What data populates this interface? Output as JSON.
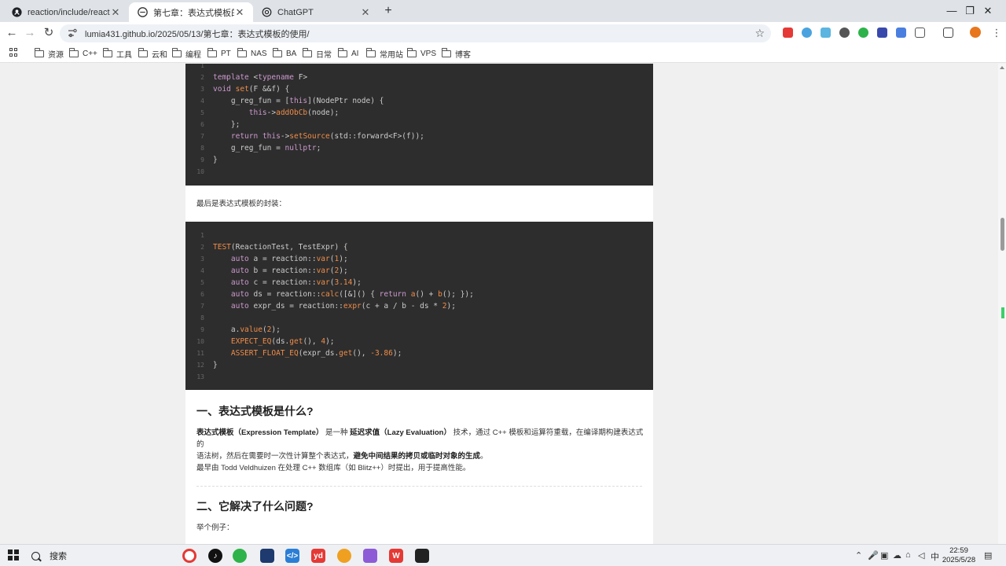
{
  "browser": {
    "tabs": [
      {
        "title": "reaction/include/reaction/ex",
        "icon": "github-icon",
        "active": false
      },
      {
        "title": "第七章：表达式模板的使用 | Lu",
        "icon": "page-icon",
        "active": true
      },
      {
        "title": "ChatGPT",
        "icon": "chatgpt-icon",
        "active": false
      }
    ],
    "new_tab": "+",
    "window_controls": {
      "minimize": "—",
      "restore": "❐",
      "close": "✕"
    },
    "url": "lumia431.github.io/2025/05/13/第七章：表达式模板的使用/",
    "nav": {
      "back": "←",
      "forward": "→",
      "reload": "↻"
    },
    "bookmarks": [
      "资源",
      "C++",
      "工具",
      "云和",
      "编程",
      "PT",
      "NAS",
      "BA",
      "日常",
      "AI",
      "常用站",
      "VPS",
      "博客"
    ]
  },
  "article": {
    "code1": [
      {
        "n": "1",
        "tokens": []
      },
      {
        "n": "2",
        "tokens": [
          [
            "kw",
            "template"
          ],
          [
            "tx",
            " <"
          ],
          [
            "kw",
            "typename"
          ],
          [
            "tx",
            " F>"
          ]
        ]
      },
      {
        "n": "3",
        "tokens": [
          [
            "kw",
            "void"
          ],
          [
            "tx",
            " "
          ],
          [
            "fn",
            "set"
          ],
          [
            "tx",
            "(F &&f) {"
          ]
        ]
      },
      {
        "n": "4",
        "tokens": [
          [
            "tx",
            "    g_reg_fun = ["
          ],
          [
            "kw",
            "this"
          ],
          [
            "tx",
            "](NodePtr node) {"
          ]
        ]
      },
      {
        "n": "5",
        "tokens": [
          [
            "tx",
            "        "
          ],
          [
            "kw",
            "this"
          ],
          [
            "tx",
            "->"
          ],
          [
            "fn",
            "addObCb"
          ],
          [
            "tx",
            "(node);"
          ]
        ]
      },
      {
        "n": "6",
        "tokens": [
          [
            "tx",
            "    };"
          ]
        ]
      },
      {
        "n": "7",
        "tokens": [
          [
            "tx",
            "    "
          ],
          [
            "kw",
            "return"
          ],
          [
            "tx",
            " "
          ],
          [
            "kw",
            "this"
          ],
          [
            "tx",
            "->"
          ],
          [
            "fn",
            "setSource"
          ],
          [
            "tx",
            "(std::forward<F>(f));"
          ]
        ]
      },
      {
        "n": "8",
        "tokens": [
          [
            "tx",
            "    g_reg_fun = "
          ],
          [
            "kw",
            "nullptr"
          ],
          [
            "tx",
            ";"
          ]
        ]
      },
      {
        "n": "9",
        "tokens": [
          [
            "tx",
            "}"
          ]
        ]
      },
      {
        "n": "10",
        "tokens": []
      }
    ],
    "intro_text": "最后是表达式模板的封装：",
    "code2": [
      {
        "n": "1",
        "tokens": []
      },
      {
        "n": "2",
        "tokens": [
          [
            "fn",
            "TEST"
          ],
          [
            "tx",
            "(ReactionTest, TestExpr) {"
          ]
        ]
      },
      {
        "n": "3",
        "tokens": [
          [
            "tx",
            "    "
          ],
          [
            "kw",
            "auto"
          ],
          [
            "tx",
            " a = reaction::"
          ],
          [
            "fn",
            "var"
          ],
          [
            "tx",
            "("
          ],
          [
            "num",
            "1"
          ],
          [
            "tx",
            ");"
          ]
        ]
      },
      {
        "n": "4",
        "tokens": [
          [
            "tx",
            "    "
          ],
          [
            "kw",
            "auto"
          ],
          [
            "tx",
            " b = reaction::"
          ],
          [
            "fn",
            "var"
          ],
          [
            "tx",
            "("
          ],
          [
            "num",
            "2"
          ],
          [
            "tx",
            ");"
          ]
        ]
      },
      {
        "n": "5",
        "tokens": [
          [
            "tx",
            "    "
          ],
          [
            "kw",
            "auto"
          ],
          [
            "tx",
            " c = reaction::"
          ],
          [
            "fn",
            "var"
          ],
          [
            "tx",
            "("
          ],
          [
            "num",
            "3.14"
          ],
          [
            "tx",
            ");"
          ]
        ]
      },
      {
        "n": "6",
        "tokens": [
          [
            "tx",
            "    "
          ],
          [
            "kw",
            "auto"
          ],
          [
            "tx",
            " ds = reaction::"
          ],
          [
            "fn",
            "calc"
          ],
          [
            "tx",
            "([&]() { "
          ],
          [
            "kw",
            "return"
          ],
          [
            "tx",
            " "
          ],
          [
            "fn",
            "a"
          ],
          [
            "tx",
            "() + "
          ],
          [
            "fn",
            "b"
          ],
          [
            "tx",
            "(); });"
          ]
        ]
      },
      {
        "n": "7",
        "tokens": [
          [
            "tx",
            "    "
          ],
          [
            "kw",
            "auto"
          ],
          [
            "tx",
            " expr_ds = reaction::"
          ],
          [
            "fn",
            "expr"
          ],
          [
            "tx",
            "(c + a / b - ds * "
          ],
          [
            "num",
            "2"
          ],
          [
            "tx",
            ");"
          ]
        ]
      },
      {
        "n": "8",
        "tokens": []
      },
      {
        "n": "9",
        "tokens": [
          [
            "tx",
            "    a."
          ],
          [
            "fn",
            "value"
          ],
          [
            "tx",
            "("
          ],
          [
            "num",
            "2"
          ],
          [
            "tx",
            ");"
          ]
        ]
      },
      {
        "n": "10",
        "tokens": [
          [
            "tx",
            "    "
          ],
          [
            "fn",
            "EXPECT_EQ"
          ],
          [
            "tx",
            "(ds."
          ],
          [
            "fn",
            "get"
          ],
          [
            "tx",
            "(), "
          ],
          [
            "num",
            "4"
          ],
          [
            "tx",
            ");"
          ]
        ]
      },
      {
        "n": "11",
        "tokens": [
          [
            "tx",
            "    "
          ],
          [
            "fn",
            "ASSERT_FLOAT_EQ"
          ],
          [
            "tx",
            "(expr_ds."
          ],
          [
            "fn",
            "get"
          ],
          [
            "tx",
            "(), "
          ],
          [
            "num",
            "-3.86"
          ],
          [
            "tx",
            ");"
          ]
        ]
      },
      {
        "n": "12",
        "tokens": [
          [
            "tx",
            "}"
          ]
        ]
      },
      {
        "n": "13",
        "tokens": []
      }
    ],
    "h2_1": "一、表达式模板是什么?",
    "p1": {
      "b1": "表达式模板（Expression Template）",
      "t1": " 是一种 ",
      "b2": "延迟求值（Lazy Evaluation）",
      "t2": " 技术，通过 C++ 模板和运算符重载，在编译期构建表达式的",
      "t3": "语法树，然后在需要时一次性计算整个表达式，",
      "b3": "避免中间结果的拷贝或临时对象的生成",
      "t4": "。"
    },
    "p2": {
      "t1": "最早由 ",
      "link": "Todd Veldhuizen",
      "t2": " 在处理 C++ 数组库（如 Blitz++）时提出，用于提高性能。"
    },
    "h2_2": "二、它解决了什么问题?",
    "p3": "举个例子："
  },
  "taskbar": {
    "search": "搜索",
    "ime": "中",
    "time": "22:59",
    "date": "2025/5/28",
    "apps": [
      "chrome-icon",
      "tiktok-icon",
      "wechat-icon",
      "files-icon",
      "vscode-icon",
      "yd-icon",
      "search-app-icon",
      "visual-studio-icon",
      "wps-icon",
      "terminal-icon"
    ]
  },
  "colors": {
    "code_bg": "#2d2d2d",
    "keyword": "#cc99cd",
    "function": "#f08d49",
    "plain": "#cccccc"
  }
}
